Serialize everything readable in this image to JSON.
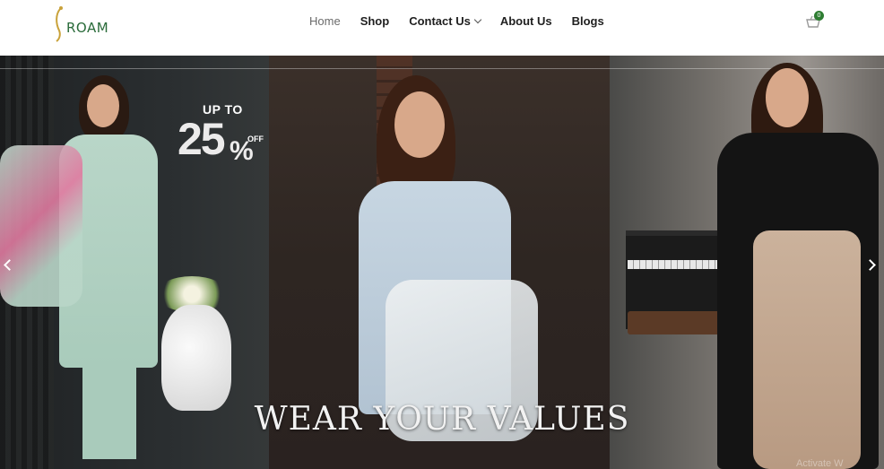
{
  "brand": {
    "logo_text": "ROAM"
  },
  "nav": {
    "items": [
      {
        "label": "Home",
        "active": true
      },
      {
        "label": "Shop",
        "active": false
      },
      {
        "label": "Contact Us",
        "active": false,
        "has_dropdown": true
      },
      {
        "label": "About Us",
        "active": false
      },
      {
        "label": "Blogs",
        "active": false
      }
    ]
  },
  "cart": {
    "count": "0",
    "icon": "shopping-basket-icon"
  },
  "hero": {
    "promo": {
      "prefix": "UP TO",
      "number": "25",
      "percent": "%",
      "suffix": "OFF"
    },
    "slogan": "WEAR YOUR VALUES",
    "prev_icon": "chevron-left-icon",
    "next_icon": "chevron-right-icon"
  },
  "watermark": {
    "text": "Activate W"
  },
  "colors": {
    "brand_green": "#2e7d32",
    "logo_gold": "#c9a23a",
    "nav_text": "#1f1f1f"
  }
}
